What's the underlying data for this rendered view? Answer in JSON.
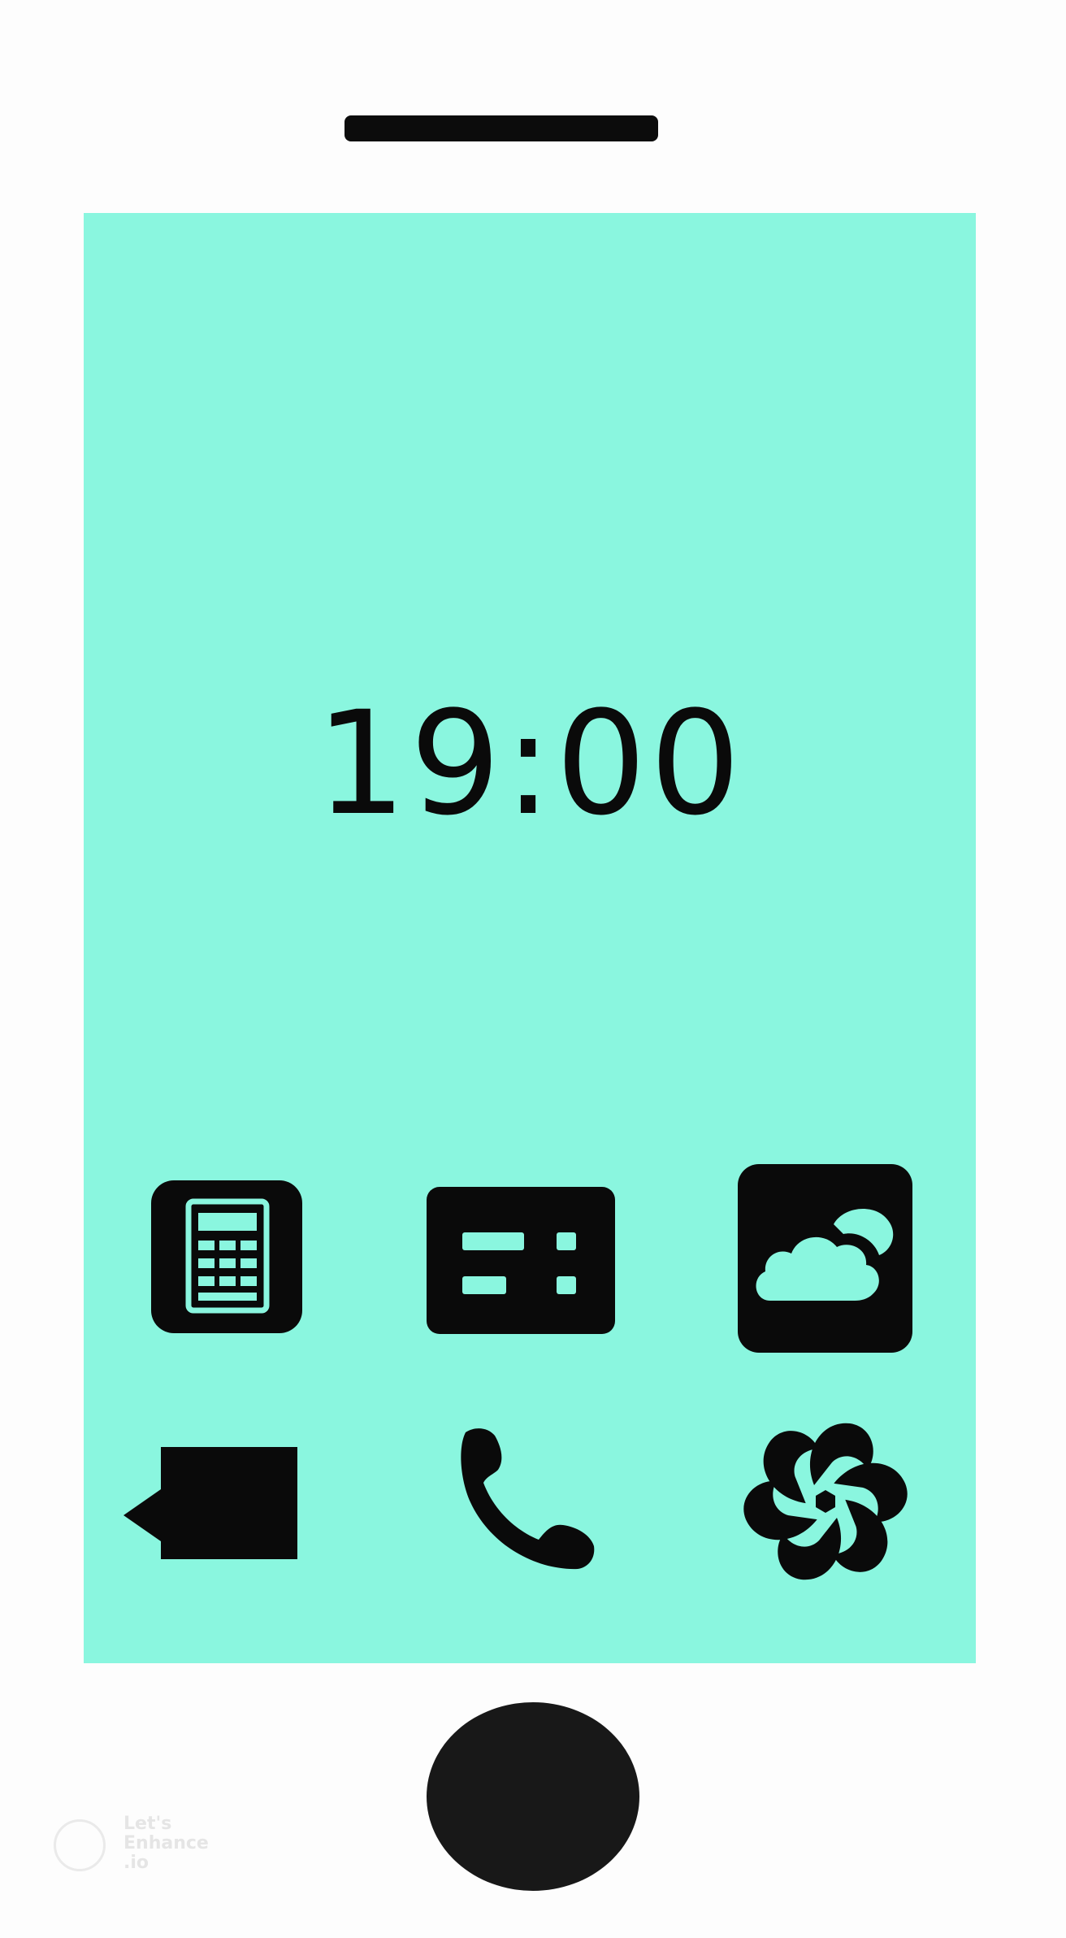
{
  "device": {
    "screen_color": "#8af6df",
    "frame_color": "#fdfdfd",
    "ink_color": "#0a0a0a"
  },
  "lock_screen": {
    "time": "19:00"
  },
  "apps": [
    {
      "id": "calculator",
      "icon": "calculator-icon"
    },
    {
      "id": "dashboard",
      "icon": "dashboard-icon"
    },
    {
      "id": "weather",
      "icon": "weather-cloud-icon"
    },
    {
      "id": "messages",
      "icon": "message-bubble-icon"
    },
    {
      "id": "phone",
      "icon": "phone-handset-icon"
    },
    {
      "id": "aperture",
      "icon": "aperture-icon"
    }
  ],
  "watermark": {
    "text": "Let's\nEnhance\n.io"
  }
}
